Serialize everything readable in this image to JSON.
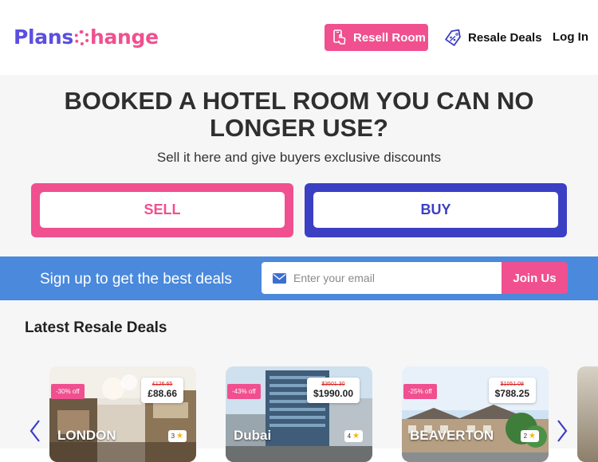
{
  "header": {
    "logo_part1": "Plans",
    "logo_part2": "hange",
    "resell_label": "Resell Room",
    "deals_label": "Resale Deals",
    "login_label": "Log In",
    "resell_icon": "phone-hand-icon",
    "deals_icon": "discount-tag-icon"
  },
  "hero": {
    "title": "BOOKED A HOTEL ROOM YOU CAN NO LONGER USE?",
    "subtitle": "Sell it here and give buyers exclusive discounts",
    "sell_label": "SELL",
    "buy_label": "BUY"
  },
  "signup": {
    "text": "Sign up to get the best deals",
    "email_placeholder": "Enter your email",
    "email_value": "",
    "email_icon": "envelope-icon",
    "join_label": "Join Us"
  },
  "deals": {
    "heading": "Latest Resale Deals",
    "cards": [
      {
        "discount": "-30% off",
        "old_price": "£126.65",
        "new_price": "£88.66",
        "city": "LONDON",
        "stars": "3"
      },
      {
        "discount": "-43% off",
        "old_price": "$3501.30",
        "new_price": "$1990.00",
        "city": "Dubai",
        "stars": "4"
      },
      {
        "discount": "-25% off",
        "old_price": "$1051.08",
        "new_price": "$788.25",
        "city": "BEAVERTON",
        "stars": "2"
      }
    ],
    "prev_icon": "chevron-left-icon",
    "next_icon": "chevron-right-icon"
  },
  "colors": {
    "brand_pink": "#f0508f",
    "brand_blue": "#3b3fc4",
    "signup_band": "#4a89dc",
    "logo_purple": "#5b4ee0"
  }
}
